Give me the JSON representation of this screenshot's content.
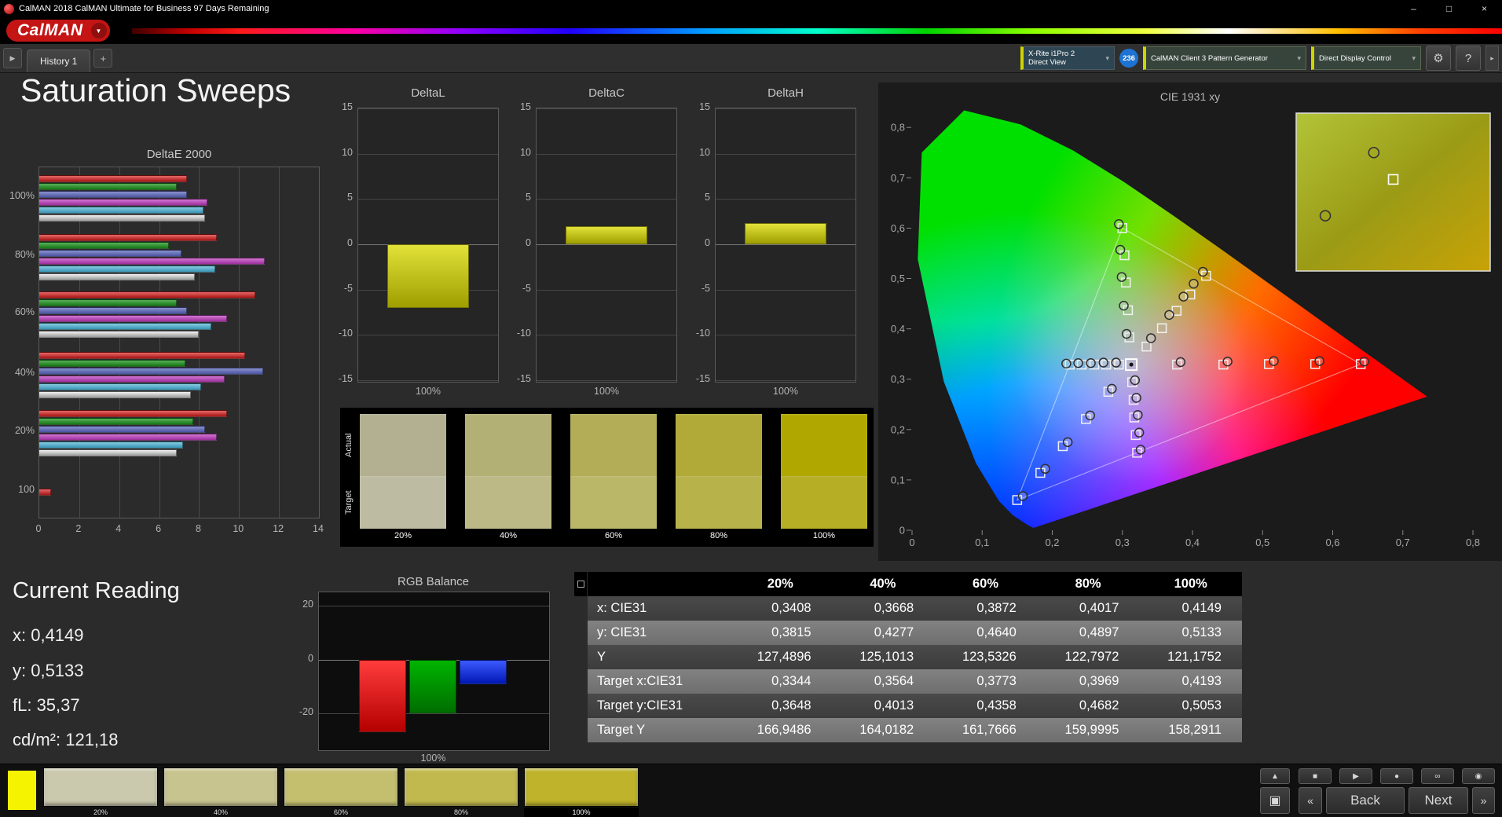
{
  "window": {
    "title": "CalMAN 2018 CalMAN Ultimate for Business 97 Days Remaining",
    "minimize": "–",
    "maximize": "□",
    "close": "×"
  },
  "logo": {
    "text": "CalMAN",
    "arrow": "▼"
  },
  "tab_bar": {
    "nav_arrow": "▶",
    "history_tab": "History 1",
    "add_tab": "+",
    "meter": {
      "line1": "X-Rite i1Pro 2",
      "line2": "Direct View",
      "chevron": "▾"
    },
    "meter_badge": "236",
    "generator": {
      "label": "CalMAN Client 3 Pattern Generator",
      "chevron": "▾"
    },
    "display_control": {
      "label": "Direct Display Control",
      "chevron": "▾"
    },
    "settings_icon": "⚙",
    "help_icon": "?",
    "edge_button": "▸"
  },
  "page_title": "Saturation Sweeps",
  "current_reading": {
    "title": "Current Reading",
    "lines": [
      "x: 0,4149",
      "y: 0,5133",
      "fL: 35,37",
      "cd/m²: 121,18"
    ]
  },
  "swatch_compare": {
    "row_labels": [
      "Actual",
      "Target"
    ],
    "columns": [
      {
        "label": "20%",
        "actual": "#b2b091",
        "target": "#bdbca2"
      },
      {
        "label": "40%",
        "actual": "#b3b075",
        "target": "#bcb987"
      },
      {
        "label": "60%",
        "actual": "#b2ad56",
        "target": "#bab768"
      },
      {
        "label": "80%",
        "actual": "#b1aa38",
        "target": "#b8b24b"
      },
      {
        "label": "100%",
        "actual": "#b0a800",
        "target": "#b6ae25"
      }
    ]
  },
  "table": {
    "headers": [
      "",
      "20%",
      "40%",
      "60%",
      "80%",
      "100%"
    ],
    "rows": [
      [
        "x: CIE31",
        "0,3408",
        "0,3668",
        "0,3872",
        "0,4017",
        "0,4149"
      ],
      [
        "y: CIE31",
        "0,3815",
        "0,4277",
        "0,4640",
        "0,4897",
        "0,5133"
      ],
      [
        "Y",
        "127,4896",
        "125,1013",
        "123,5326",
        "122,7972",
        "121,1752"
      ],
      [
        "Target x:CIE31",
        "0,3344",
        "0,3564",
        "0,3773",
        "0,3969",
        "0,4193"
      ],
      [
        "Target y:CIE31",
        "0,3648",
        "0,4013",
        "0,4358",
        "0,4682",
        "0,5053"
      ],
      [
        "Target Y",
        "166,9486",
        "164,0182",
        "161,7666",
        "159,9995",
        "158,2911"
      ]
    ]
  },
  "bottom_bar": {
    "active_patch_color": "#f6f300",
    "swatches": [
      {
        "label": "20%",
        "color": "#cbc9ad"
      },
      {
        "label": "40%",
        "color": "#c8c490"
      },
      {
        "label": "60%",
        "color": "#c4bf6f"
      },
      {
        "label": "80%",
        "color": "#c1b94e"
      },
      {
        "label": "100%",
        "color": "#beb32a",
        "selected": true
      }
    ],
    "transport": {
      "up": "▲",
      "pattern": "▣",
      "row": [
        "■",
        "▶",
        "●",
        "∞",
        "◉"
      ]
    },
    "nav": {
      "skip_back": "«",
      "back": "Back",
      "next": "Next",
      "skip_forward": "»"
    }
  },
  "chart_data": [
    {
      "id": "deltae2000",
      "type": "bar",
      "orientation": "horizontal",
      "title": "DeltaE 2000",
      "xlim": [
        0,
        14
      ],
      "x_ticks": [
        0,
        2,
        4,
        6,
        8,
        10,
        12,
        14
      ],
      "grid": true,
      "groups": [
        {
          "label": "100%",
          "values": [
            7.4,
            6.9,
            7.4,
            8.4,
            8.2,
            8.3
          ]
        },
        {
          "label": "80%",
          "values": [
            8.9,
            6.5,
            7.1,
            11.3,
            8.8,
            7.8
          ]
        },
        {
          "label": "60%",
          "values": [
            10.8,
            6.9,
            7.4,
            9.4,
            8.6,
            8.0
          ]
        },
        {
          "label": "40%",
          "values": [
            10.3,
            7.3,
            11.2,
            9.3,
            8.1,
            7.6
          ]
        },
        {
          "label": "20%",
          "values": [
            9.4,
            7.7,
            8.3,
            8.9,
            7.2,
            6.9
          ]
        },
        {
          "label": "100",
          "values": [
            0.6
          ]
        }
      ],
      "series_colors": [
        {
          "name": "red",
          "light": "#e86868",
          "dark": "#a81414"
        },
        {
          "name": "green",
          "light": "#58b058",
          "dark": "#157815"
        },
        {
          "name": "blue",
          "light": "#8a92cc",
          "dark": "#4a54a2"
        },
        {
          "name": "magenta",
          "light": "#d276d2",
          "dark": "#9c2e9c"
        },
        {
          "name": "cyan",
          "light": "#86cce0",
          "dark": "#3894b4"
        },
        {
          "name": "white",
          "light": "#f2f2f2",
          "dark": "#9a9a9a"
        }
      ]
    },
    {
      "id": "deltal",
      "type": "bar",
      "title": "DeltaL",
      "ylim": [
        -15,
        15
      ],
      "y_ticks": [
        15,
        10,
        5,
        0,
        -5,
        -10,
        -15
      ],
      "categories": [
        "100%"
      ],
      "values": [
        -7.0
      ]
    },
    {
      "id": "deltac",
      "type": "bar",
      "title": "DeltaC",
      "ylim": [
        -15,
        15
      ],
      "y_ticks": [
        15,
        10,
        5,
        0,
        -5,
        -10,
        -15
      ],
      "categories": [
        "100%"
      ],
      "values": [
        2.0
      ]
    },
    {
      "id": "deltah",
      "type": "bar",
      "title": "DeltaH",
      "ylim": [
        -15,
        15
      ],
      "y_ticks": [
        15,
        10,
        5,
        0,
        -5,
        -10,
        -15
      ],
      "categories": [
        "100%"
      ],
      "values": [
        2.3
      ]
    },
    {
      "id": "rgb_balance",
      "type": "bar",
      "title": "RGB Balance",
      "ylim": [
        25,
        -33
      ],
      "y_ticks": [
        20,
        0,
        -20
      ],
      "categories": [
        "100%"
      ],
      "series": [
        {
          "name": "Red",
          "value": -27,
          "light": "#ff3c3c",
          "dark": "#b40000"
        },
        {
          "name": "Green",
          "value": -20,
          "light": "#00b400",
          "dark": "#006e00"
        },
        {
          "name": "Blue",
          "value": -9,
          "light": "#3c5aff",
          "dark": "#0018b4"
        }
      ]
    },
    {
      "id": "cie1931",
      "type": "scatter",
      "title": "CIE 1931 xy",
      "xlim": [
        0,
        0.8
      ],
      "ylim": [
        0,
        0.8
      ],
      "x_ticks": [
        "0",
        "0,1",
        "0,2",
        "0,3",
        "0,4",
        "0,5",
        "0,6",
        "0,7",
        "0,8"
      ],
      "y_ticks": [
        "0",
        "0,1",
        "0,2",
        "0,3",
        "0,4",
        "0,5",
        "0,6",
        "0,7",
        "0,8"
      ],
      "white_point": [
        0.3127,
        0.329
      ],
      "gamut_triangle": {
        "red": [
          0.64,
          0.33
        ],
        "green": [
          0.3,
          0.6
        ],
        "blue": [
          0.15,
          0.06
        ]
      },
      "locus": [
        [
          0.1741,
          0.005
        ],
        [
          0.1726,
          0.0048
        ],
        [
          0.1644,
          0.0109
        ],
        [
          0.144,
          0.0297
        ],
        [
          0.1241,
          0.0578
        ],
        [
          0.0913,
          0.1327
        ],
        [
          0.0454,
          0.295
        ],
        [
          0.0082,
          0.5384
        ],
        [
          0.0139,
          0.7502
        ],
        [
          0.0743,
          0.8338
        ],
        [
          0.1547,
          0.8059
        ],
        [
          0.2296,
          0.7543
        ],
        [
          0.3016,
          0.6923
        ],
        [
          0.3731,
          0.6245
        ],
        [
          0.4441,
          0.5547
        ],
        [
          0.5125,
          0.4866
        ],
        [
          0.5752,
          0.4242
        ],
        [
          0.627,
          0.3725
        ],
        [
          0.6658,
          0.334
        ],
        [
          0.6915,
          0.3083
        ],
        [
          0.719,
          0.2809
        ],
        [
          0.7347,
          0.2653
        ]
      ],
      "target_squares": [
        [
          0.378,
          0.329
        ],
        [
          0.444,
          0.329
        ],
        [
          0.509,
          0.33
        ],
        [
          0.575,
          0.33
        ],
        [
          0.64,
          0.33
        ],
        [
          0.31,
          0.383
        ],
        [
          0.308,
          0.437
        ],
        [
          0.305,
          0.492
        ],
        [
          0.303,
          0.546
        ],
        [
          0.3,
          0.6
        ],
        [
          0.28,
          0.275
        ],
        [
          0.248,
          0.221
        ],
        [
          0.215,
          0.167
        ],
        [
          0.183,
          0.114
        ],
        [
          0.15,
          0.06
        ],
        [
          0.295,
          0.329
        ],
        [
          0.277,
          0.329
        ],
        [
          0.26,
          0.329
        ],
        [
          0.242,
          0.329
        ],
        [
          0.225,
          0.329
        ],
        [
          0.314,
          0.294
        ],
        [
          0.316,
          0.259
        ],
        [
          0.317,
          0.224
        ],
        [
          0.319,
          0.189
        ],
        [
          0.321,
          0.154
        ],
        [
          0.3344,
          0.3648
        ],
        [
          0.3564,
          0.4013
        ],
        [
          0.3773,
          0.4358
        ],
        [
          0.3969,
          0.4682
        ],
        [
          0.4193,
          0.5053
        ]
      ],
      "measured_circles": [
        [
          0.383,
          0.334
        ],
        [
          0.45,
          0.335
        ],
        [
          0.516,
          0.336
        ],
        [
          0.581,
          0.336
        ],
        [
          0.645,
          0.335
        ],
        [
          0.306,
          0.39
        ],
        [
          0.302,
          0.446
        ],
        [
          0.299,
          0.503
        ],
        [
          0.297,
          0.557
        ],
        [
          0.295,
          0.608
        ],
        [
          0.285,
          0.281
        ],
        [
          0.254,
          0.228
        ],
        [
          0.222,
          0.175
        ],
        [
          0.19,
          0.122
        ],
        [
          0.158,
          0.068
        ],
        [
          0.291,
          0.333
        ],
        [
          0.273,
          0.333
        ],
        [
          0.255,
          0.332
        ],
        [
          0.237,
          0.332
        ],
        [
          0.22,
          0.331
        ],
        [
          0.318,
          0.298
        ],
        [
          0.32,
          0.263
        ],
        [
          0.322,
          0.229
        ],
        [
          0.324,
          0.194
        ],
        [
          0.326,
          0.16
        ],
        [
          0.3408,
          0.3815
        ],
        [
          0.3668,
          0.4277
        ],
        [
          0.3872,
          0.464
        ],
        [
          0.4017,
          0.4897
        ],
        [
          0.4149,
          0.5133
        ]
      ],
      "inset": {
        "markers": [
          {
            "type": "circle",
            "fx": 0.4,
            "fy": 0.25
          },
          {
            "type": "square",
            "fx": 0.5,
            "fy": 0.42
          },
          {
            "type": "circle",
            "fx": 0.15,
            "fy": 0.65
          }
        ]
      }
    }
  ]
}
